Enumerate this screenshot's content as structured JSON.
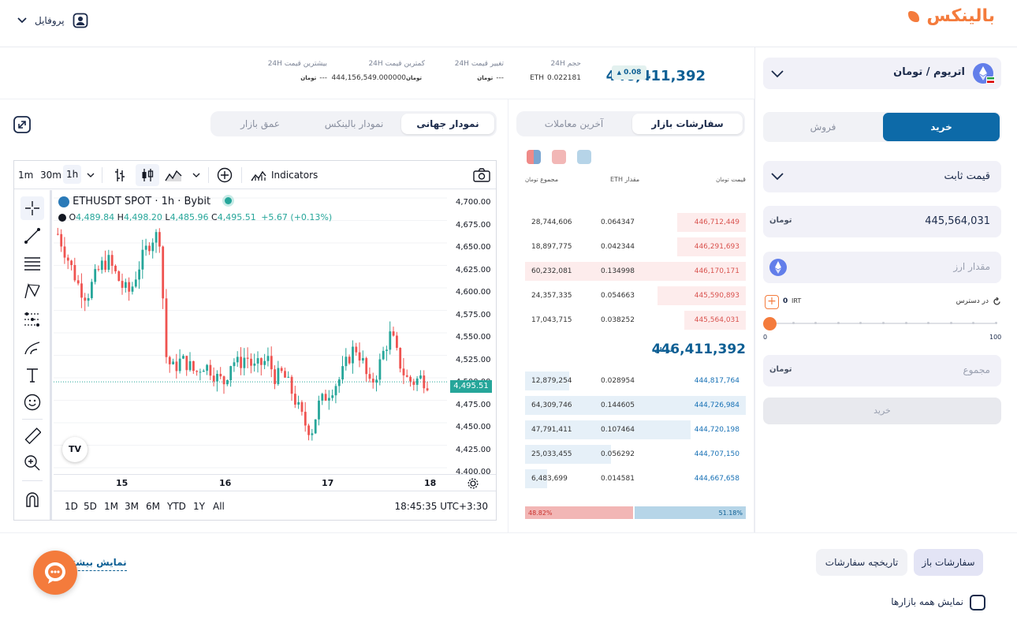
{
  "header": {
    "logo": "بالینکس",
    "profile_label": "پروفایل"
  },
  "market": {
    "pair": "اتریوم / تومان",
    "last_price": "446,411,392",
    "change_pct": "0.08",
    "stats": [
      {
        "label": "حجم 24H",
        "value": "0.022181",
        "unit": "ETH"
      },
      {
        "label": "تغییر قیمت 24H",
        "value": "---"
      },
      {
        "label": "کمترین قیمت 24H",
        "value": "444,156,549.000000"
      },
      {
        "label": "بیشترین قیمت 24H",
        "value": "---"
      }
    ]
  },
  "chart_tabs": [
    "نمودار جهانی",
    "نمودار بالینکس",
    "عمق بازار"
  ],
  "book_tabs": [
    "سفارشات بازار",
    "آخرین معاملات"
  ],
  "book": {
    "headers": {
      "price": "قیمت",
      "amount": "مقدار",
      "amount_unit": "ETH",
      "total": "مجموع"
    },
    "asks": [
      {
        "price": "446,712,449",
        "amount": "0.064347",
        "total": "28,744,606",
        "depth": 0.31
      },
      {
        "price": "446,291,693",
        "amount": "0.042344",
        "total": "18,897,775",
        "depth": 0.31
      },
      {
        "price": "446,170,171",
        "amount": "0.134998",
        "total": "60,232,081",
        "depth": 1.0
      },
      {
        "price": "445,590,893",
        "amount": "0.054663",
        "total": "24,357,335",
        "depth": 0.4
      },
      {
        "price": "445,564,031",
        "amount": "0.038252",
        "total": "17,043,715",
        "depth": 0.28
      }
    ],
    "mid_price": "446,411,392",
    "bids": [
      {
        "price": "444,817,764",
        "amount": "0.028954",
        "total": "12,879,254",
        "depth": 0.2
      },
      {
        "price": "444,726,984",
        "amount": "0.144605",
        "total": "64,309,746",
        "depth": 1.0
      },
      {
        "price": "444,720,198",
        "amount": "0.107464",
        "total": "47,791,411",
        "depth": 0.75
      },
      {
        "price": "444,707,150",
        "amount": "0.056292",
        "total": "25,033,455",
        "depth": 0.39
      },
      {
        "price": "444,667,658",
        "amount": "0.014581",
        "total": "6,483,699",
        "depth": 0.1
      }
    ],
    "sell_pct": "48.82%",
    "buy_pct": "51.18%",
    "sell_ratio": 0.4882
  },
  "trade": {
    "buy_label": "خرید",
    "sell_label": "فروش",
    "order_type": "قیمت ثابت",
    "price_value": "445,564,031",
    "amount_placeholder": "مقدار ارز",
    "available_label": "در دسترس",
    "available_value": "0",
    "available_unit": "IRT",
    "slider_min": "0",
    "slider_max": "100",
    "slider_value": 0,
    "total_placeholder": "مجموع",
    "submit_label": "خرید"
  },
  "tv": {
    "intervals": [
      "1m",
      "30m",
      "1h"
    ],
    "indicators_label": "Indicators",
    "symbol": "ETHUSDT SPOT · 1h · Bybit",
    "ohlc": {
      "o": "4,489.84",
      "h": "4,498.20",
      "l": "4,485.96",
      "c": "4,495.51",
      "chg": "+5.67 (+0.13%)"
    },
    "ohlc_keys": {
      "o": "O",
      "h": "H",
      "l": "L",
      "c": "C"
    },
    "price_tag": "4,495.51",
    "y_labels": [
      "4,700.00",
      "4,675.00",
      "4,650.00",
      "4,625.00",
      "4,600.00",
      "4,575.00",
      "4,550.00",
      "4,525.00",
      "4,500.00",
      "4,475.00",
      "4,450.00",
      "4,425.00",
      "4,400.00"
    ],
    "x_labels": [
      "15",
      "16",
      "17",
      "18"
    ],
    "ranges": [
      "1D",
      "5D",
      "1M",
      "3M",
      "6M",
      "YTD",
      "1Y",
      "All"
    ],
    "clock": "18:45:35 UTC+3:30",
    "tv_logo": "TV"
  },
  "orders": {
    "tabs": [
      "سفارشات باز",
      "تاریخچه سفارشات"
    ],
    "show_more": "نمایش بیشتر",
    "show_all": "نمایش همه بازارها"
  },
  "currency_icon": "toman-icon",
  "currency_text": "تومان",
  "colors": {
    "brand": "#f47b3c",
    "primary": "#0d6aa8",
    "up": "#26a69a",
    "down": "#ef5350",
    "ask": "#d9534f",
    "bid": "#1670b5"
  }
}
